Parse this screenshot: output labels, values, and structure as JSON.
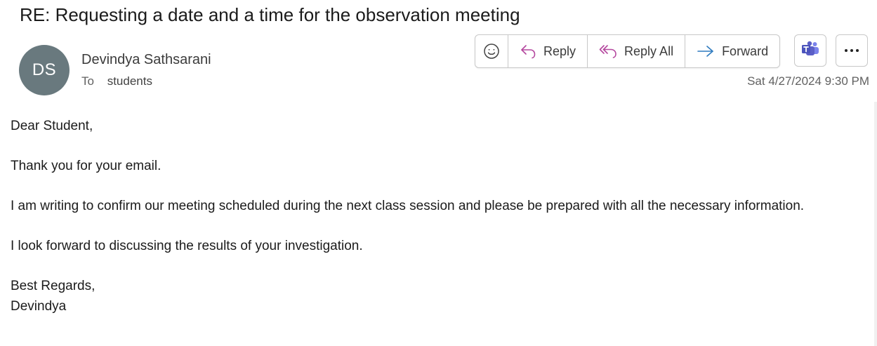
{
  "email": {
    "subject": "RE: Requesting a date and a time for the observation meeting",
    "sender": {
      "initials": "DS",
      "name": "Devindya Sathsarani",
      "avatar_color": "#69797e"
    },
    "to_label": "To",
    "to_value": "students",
    "timestamp": "Sat 4/27/2024 9:30 PM",
    "body": {
      "greeting": "Dear Student,",
      "line1": "Thank you for your email.",
      "line2": "I am writing to confirm our meeting scheduled during the next class session and please be prepared with all the necessary information.",
      "line3": "I look forward to discussing the results of your investigation.",
      "closing": "Best Regards,",
      "signature": "Devindya"
    }
  },
  "toolbar": {
    "emoji_icon": "smiley-icon",
    "reply_label": "Reply",
    "reply_all_label": "Reply All",
    "forward_label": "Forward",
    "teams_icon": "teams-icon",
    "more_icon": "more-options-icon"
  },
  "colors": {
    "reply_icon": "#b4479e",
    "forward_icon": "#2f7bbf",
    "teams": "#5b5fc7"
  }
}
